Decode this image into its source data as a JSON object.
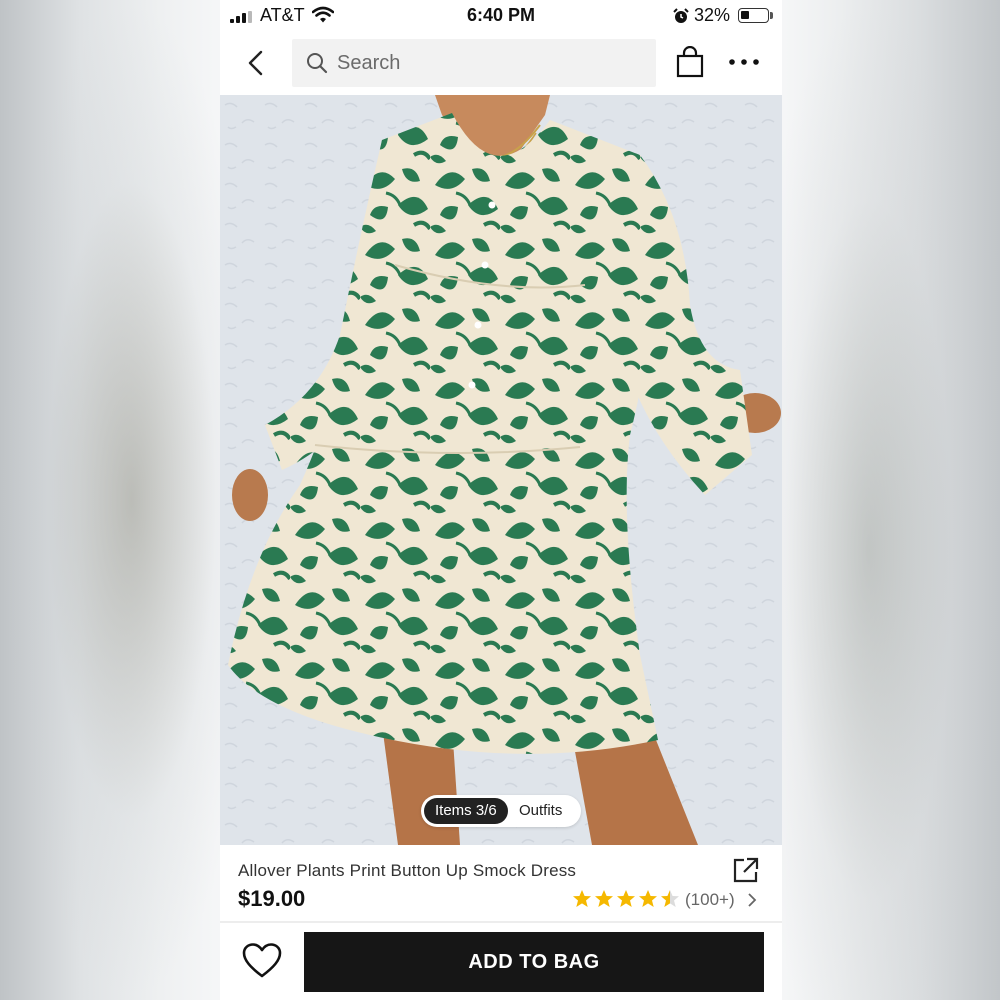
{
  "status_bar": {
    "carrier": "AT&T",
    "time": "6:40 PM",
    "battery_percent": "32%",
    "battery_level": 0.32,
    "signal_bars": 3,
    "icons": [
      "signal-icon",
      "wifi-icon",
      "alarm-icon",
      "battery-icon"
    ]
  },
  "nav": {
    "back_icon": "chevron-left-icon",
    "search_placeholder": "Search",
    "bag_icon": "shopping-bag-icon",
    "more_icon": "more-dots-icon"
  },
  "gallery": {
    "items_label": "Items 3/6",
    "outfits_label": "Outfits",
    "image": "green-leaf-print-smock-dress-photo"
  },
  "product": {
    "title": "Allover Plants Print Button Up Smock Dress",
    "price": "$19.00",
    "rating": 4.5,
    "reviews_label": "(100+)",
    "star_color": "#f5b800",
    "share_icon": "share-icon"
  },
  "actions": {
    "wishlist_icon": "heart-icon",
    "add_to_bag_label": "ADD TO BAG"
  },
  "colors": {
    "dress_green": "#2a7a52",
    "dress_cream": "#f0e7d3",
    "button_dark": "#161616"
  }
}
